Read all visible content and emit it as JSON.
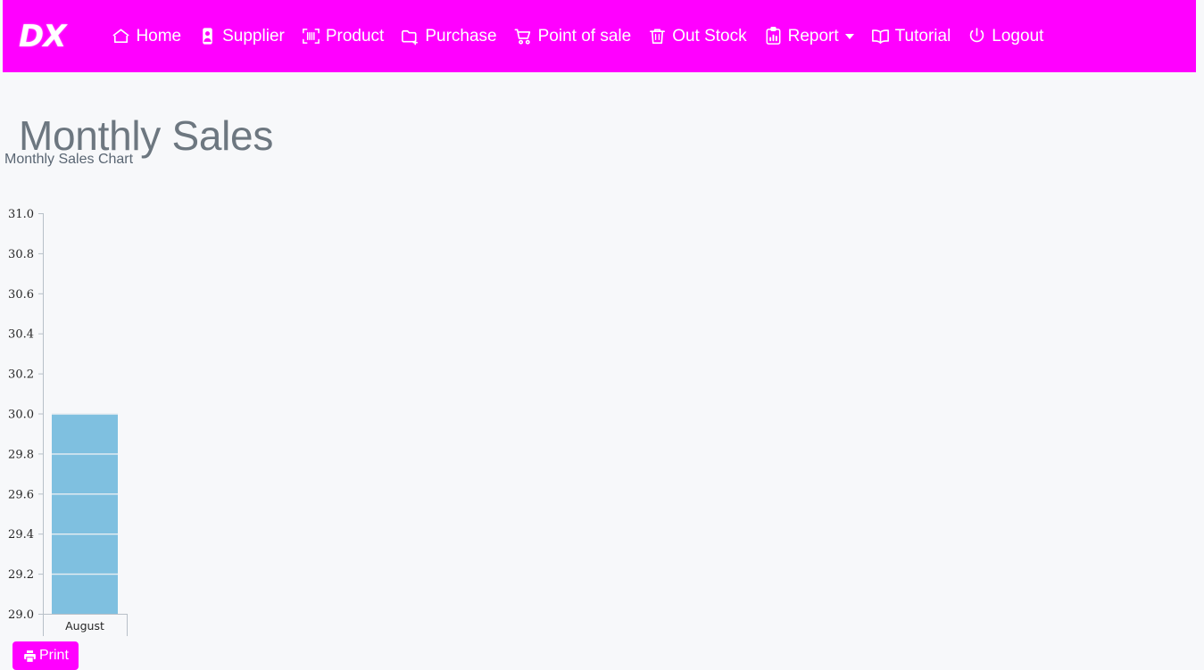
{
  "navbar": {
    "brand": "DX",
    "background": "#ff00ff",
    "text_color": "#ffffff",
    "items": [
      {
        "label": "Home",
        "icon": "home-icon",
        "dropdown": false
      },
      {
        "label": "Supplier",
        "icon": "contact-card-icon",
        "dropdown": false
      },
      {
        "label": "Product",
        "icon": "barcode-icon",
        "dropdown": false
      },
      {
        "label": "Purchase",
        "icon": "folder-plus-icon",
        "dropdown": false
      },
      {
        "label": "Point of sale",
        "icon": "shopping-cart-icon",
        "dropdown": false
      },
      {
        "label": "Out Stock",
        "icon": "trash-icon",
        "dropdown": false
      },
      {
        "label": "Report",
        "icon": "report-chart-icon",
        "dropdown": true
      },
      {
        "label": "Tutorial",
        "icon": "book-icon",
        "dropdown": false
      },
      {
        "label": "Logout",
        "icon": "power-icon",
        "dropdown": false
      }
    ]
  },
  "main": {
    "title": "Monthly Sales",
    "subtitle": "Monthly Sales Chart",
    "title_color": "#6d7780",
    "background": "#f7f8fa"
  },
  "print_button": {
    "label": "Print",
    "icon": "printer-icon",
    "background": "#ff00ff",
    "text_color": "#ffffff"
  },
  "chart_data": {
    "type": "bar",
    "title": "",
    "xlabel": "",
    "ylabel": "",
    "categories": [
      "August"
    ],
    "values": [
      30.0
    ],
    "series": [
      {
        "name": "Monthly Sales",
        "values": [
          30.0
        ]
      }
    ],
    "ylim": [
      29.0,
      31.0
    ],
    "yticks": [
      "29.0",
      "29.2",
      "29.4",
      "29.6",
      "29.8",
      "30.0",
      "30.2",
      "30.4",
      "30.6",
      "30.8",
      "31.0"
    ],
    "ytick_values": [
      29.0,
      29.2,
      29.4,
      29.6,
      29.8,
      30.0,
      30.2,
      30.4,
      30.6,
      30.8,
      31.0
    ],
    "xticks": [
      "August"
    ],
    "bar_color": "#7fc0e0",
    "gridline_color": "#e9eef2",
    "axis_color": "#b8c0c8",
    "tick_label_color": "#262626",
    "grid": true,
    "legend": false
  }
}
